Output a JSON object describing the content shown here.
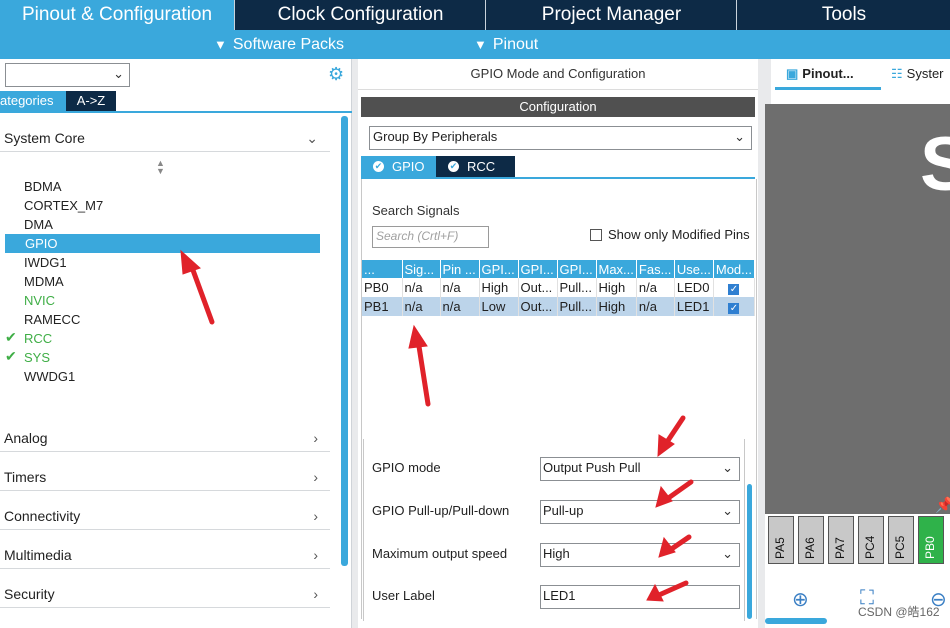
{
  "top_tabs": [
    "Pinout & Configuration",
    "Clock Configuration",
    "Project Manager",
    "Tools"
  ],
  "sub_menu": [
    "Software Packs",
    "Pinout"
  ],
  "left": {
    "categories_tab": "ategories",
    "az_tab": "A->Z",
    "system_core": "System Core",
    "items": [
      {
        "label": "BDMA",
        "status": "normal"
      },
      {
        "label": "CORTEX_M7",
        "status": "normal"
      },
      {
        "label": "DMA",
        "status": "normal"
      },
      {
        "label": "GPIO",
        "status": "selected"
      },
      {
        "label": "IWDG1",
        "status": "normal"
      },
      {
        "label": "MDMA",
        "status": "normal"
      },
      {
        "label": "NVIC",
        "status": "green"
      },
      {
        "label": "RAMECC",
        "status": "normal"
      },
      {
        "label": "RCC",
        "status": "checked"
      },
      {
        "label": "SYS",
        "status": "checked"
      },
      {
        "label": "WWDG1",
        "status": "normal"
      }
    ],
    "sections": [
      "Analog",
      "Timers",
      "Connectivity",
      "Multimedia",
      "Security"
    ]
  },
  "middle": {
    "title": "GPIO Mode and Configuration",
    "config_label": "Configuration",
    "group_by": "Group By Peripherals",
    "tabs": [
      "GPIO",
      "RCC"
    ],
    "search_label": "Search Signals",
    "search_placeholder": "Search (Crtl+F)",
    "show_modified": "Show only Modified Pins",
    "table_headers": [
      "...",
      "Sig...",
      "Pin ...",
      "GPI...",
      "GPI...",
      "GPI...",
      "Max...",
      "Fas...",
      "Use...",
      "Mod..."
    ],
    "rows": [
      [
        "PB0",
        "n/a",
        "n/a",
        "High",
        "Out...",
        "Pull...",
        "High",
        "n/a",
        "LED0",
        "✓"
      ],
      [
        "PB1",
        "n/a",
        "n/a",
        "Low",
        "Out...",
        "Pull...",
        "High",
        "n/a",
        "LED1",
        "✓"
      ]
    ],
    "gpio_mode_label": "GPIO mode",
    "gpio_mode_value": "Output Push Pull",
    "pull_label": "GPIO Pull-up/Pull-down",
    "pull_value": "Pull-up",
    "speed_label": "Maximum output speed",
    "speed_value": "High",
    "user_label_label": "User Label",
    "user_label_value": "LED1"
  },
  "right": {
    "tab_pinout": "Pinout...",
    "tab_system": "Syster",
    "chip_letter": "S",
    "pins": [
      "PA5",
      "PA6",
      "PA7",
      "PC4",
      "PC5",
      "PB0"
    ],
    "watermark": "CSDN @皓162"
  },
  "colors": {
    "accent": "#3aa8dc",
    "navy": "#0d2a46",
    "pin_active": "#2fb24a",
    "arrow": "#e0222a"
  }
}
